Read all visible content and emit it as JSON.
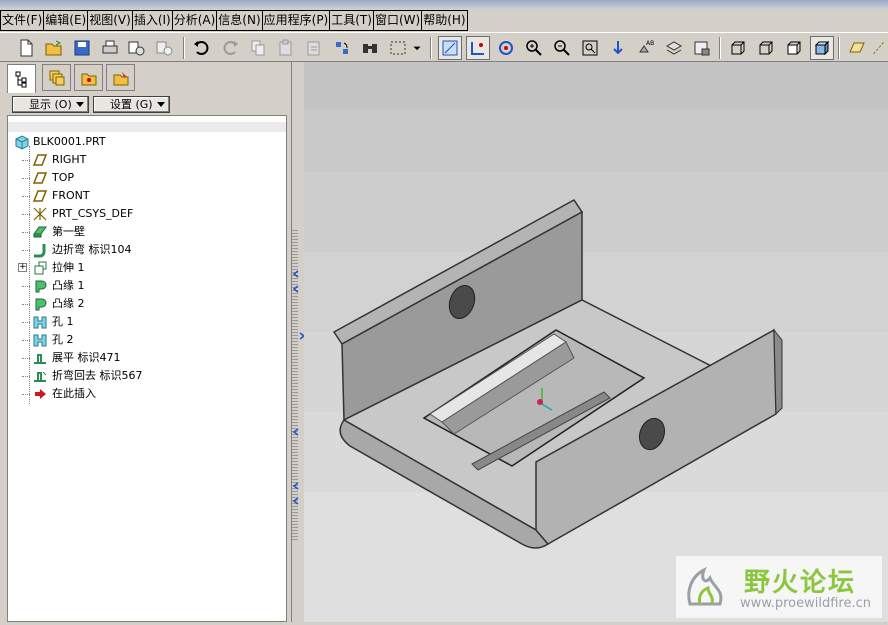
{
  "menu": [
    "文件(F)",
    "编辑(E)",
    "视图(V)",
    "插入(I)",
    "分析(A)",
    "信息(N)",
    "应用程序(P)",
    "工具(T)",
    "窗口(W)",
    "帮助(H)"
  ],
  "panel": {
    "tabs": [
      "model-tree-icon",
      "layers-icon",
      "folder-icon",
      "favorites-icon"
    ],
    "display_btn": "显示 (O)",
    "settings_btn": "设置 (G)"
  },
  "tree": {
    "root": "BLK0001.PRT",
    "items": [
      {
        "label": "RIGHT",
        "icon": "datum-plane-icon"
      },
      {
        "label": "TOP",
        "icon": "datum-plane-icon"
      },
      {
        "label": "FRONT",
        "icon": "datum-plane-icon"
      },
      {
        "label": "PRT_CSYS_DEF",
        "icon": "csys-icon"
      },
      {
        "label": "第一壁",
        "icon": "first-wall-icon"
      },
      {
        "label": "边折弯 标识104",
        "icon": "edge-bend-icon"
      },
      {
        "label": "拉伸 1",
        "icon": "extrude-icon"
      },
      {
        "label": "凸缘 1",
        "icon": "flange-icon"
      },
      {
        "label": "凸缘 2",
        "icon": "flange-icon"
      },
      {
        "label": "孔 1",
        "icon": "hole-icon"
      },
      {
        "label": "孔 2",
        "icon": "hole-icon"
      },
      {
        "label": "展平 标识471",
        "icon": "unbend-icon"
      },
      {
        "label": "折弯回去 标识567",
        "icon": "bendback-icon"
      },
      {
        "label": "在此插入",
        "icon": "insert-here-icon"
      }
    ]
  },
  "watermark": {
    "title": "野火论坛",
    "url": "www.proewildfire.cn"
  },
  "colors": {
    "window_bg": "#d4d0c8",
    "accent_blue": "#1e54c8",
    "watermark_green": "#8cc63e",
    "watermark_grey": "#9aa0a6"
  }
}
